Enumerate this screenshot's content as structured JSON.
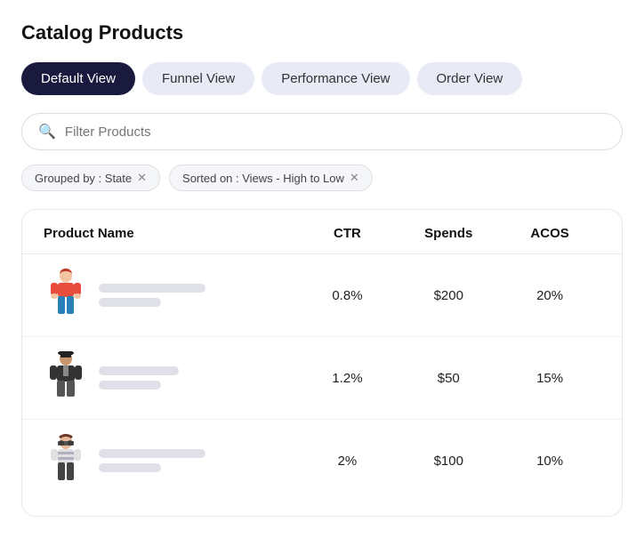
{
  "page": {
    "title": "Catalog Products"
  },
  "tabs": [
    {
      "id": "default",
      "label": "Default View",
      "active": true
    },
    {
      "id": "funnel",
      "label": "Funnel View",
      "active": false
    },
    {
      "id": "performance",
      "label": "Performance View",
      "active": false
    },
    {
      "id": "order",
      "label": "Order View",
      "active": false
    }
  ],
  "search": {
    "placeholder": "Filter Products"
  },
  "filters": [
    {
      "id": "state",
      "label": "Grouped by : State",
      "removable": true
    },
    {
      "id": "views",
      "label": "Sorted on : Views - High to Low",
      "removable": true
    }
  ],
  "table": {
    "columns": [
      "Product Name",
      "CTR",
      "Spends",
      "ACOS"
    ],
    "rows": [
      {
        "ctr": "0.8%",
        "spends": "$200",
        "acos": "20%",
        "person": "1"
      },
      {
        "ctr": "1.2%",
        "spends": "$50",
        "acos": "15%",
        "person": "2"
      },
      {
        "ctr": "2%",
        "spends": "$100",
        "acos": "10%",
        "person": "3"
      }
    ]
  }
}
